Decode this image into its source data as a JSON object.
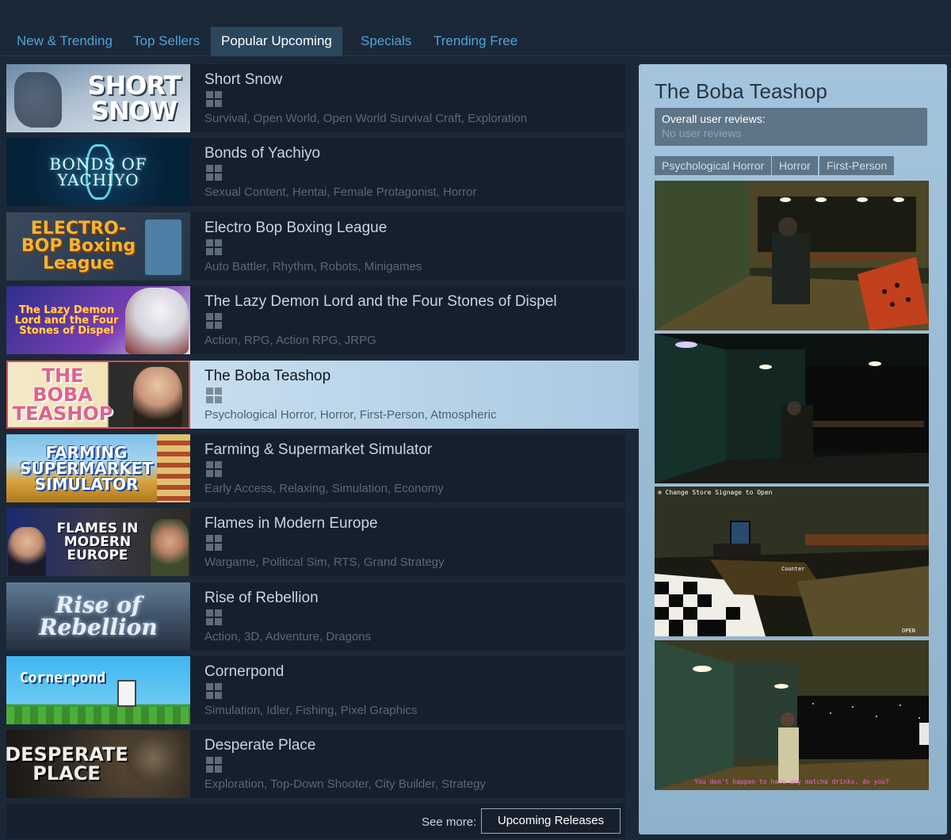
{
  "tabs": [
    {
      "label": "New & Trending"
    },
    {
      "label": "Top Sellers"
    },
    {
      "label": "Popular Upcoming",
      "active": true
    },
    {
      "label": "Specials"
    },
    {
      "label": "Trending Free"
    }
  ],
  "games": [
    {
      "title": "Short Snow",
      "tags": "Survival, Open World, Open World Survival Craft, Exploration",
      "capsule": "SHORT SNOW",
      "platform": "windows-icon"
    },
    {
      "title": "Bonds of Yachiyo",
      "tags": "Sexual Content, Hentai, Female Protagonist, Horror",
      "capsule": "BONDS OF YACHIYO",
      "platform": "windows-icon"
    },
    {
      "title": "Electro Bop Boxing League",
      "tags": "Auto Battler, Rhythm, Robots, Minigames",
      "capsule": "ELECTRO-BOP Boxing League",
      "platform": "windows-icon"
    },
    {
      "title": "The Lazy Demon Lord and the Four Stones of Dispel",
      "tags": "Action, RPG, Action RPG, JRPG",
      "capsule": "The Lazy Demon Lord and the Four Stones of Dispel",
      "platform": "windows-icon"
    },
    {
      "title": "The Boba Teashop",
      "tags": "Psychological Horror, Horror, First-Person, Atmospheric",
      "capsule": "THE BOBA TEASHOP",
      "platform": "windows-icon",
      "active": true
    },
    {
      "title": "Farming & Supermarket Simulator",
      "tags": "Early Access, Relaxing, Simulation, Economy",
      "capsule": "FARMING SUPERMARKET SIMULATOR",
      "platform": "windows-icon"
    },
    {
      "title": "Flames in Modern Europe",
      "tags": "Wargame, Political Sim, RTS, Grand Strategy",
      "capsule": "FLAMES IN MODERN EUROPE",
      "platform": "windows-icon"
    },
    {
      "title": "Rise of Rebellion",
      "tags": "Action, 3D, Adventure, Dragons",
      "capsule": "Rise of Rebellion",
      "platform": "windows-icon"
    },
    {
      "title": "Cornerpond",
      "tags": "Simulation, Idler, Fishing, Pixel Graphics",
      "capsule": "Cornerpond",
      "platform": "windows-icon"
    },
    {
      "title": "Desperate Place",
      "tags": "Exploration, Top-Down Shooter, City Builder, Strategy",
      "capsule": "DESPERATE PLACE",
      "platform": "windows-icon"
    }
  ],
  "see_more": {
    "label": "See more:",
    "button": "Upcoming Releases"
  },
  "preview": {
    "title": "The Boba Teashop",
    "reviews_label": "Overall user reviews:",
    "reviews_value": "No user reviews",
    "tags": [
      "Psychological Horror",
      "Horror",
      "First-Person"
    ],
    "screenshots": [
      {
        "caption": ""
      },
      {
        "caption": ""
      },
      {
        "caption": "⊕ Change Store Signage to Open",
        "label": "Counter",
        "corner": "OPEN"
      },
      {
        "caption": "You don't happen to have any matcha drinks, do you?"
      }
    ]
  },
  "colors": {
    "background": "#1b2838",
    "tab_link": "#4fa3d9",
    "active_tab_bg": "#2a475e",
    "row_bg": "#16202d",
    "preview_bg": "#a3c4dc",
    "tag_bg": "#5e7587"
  }
}
